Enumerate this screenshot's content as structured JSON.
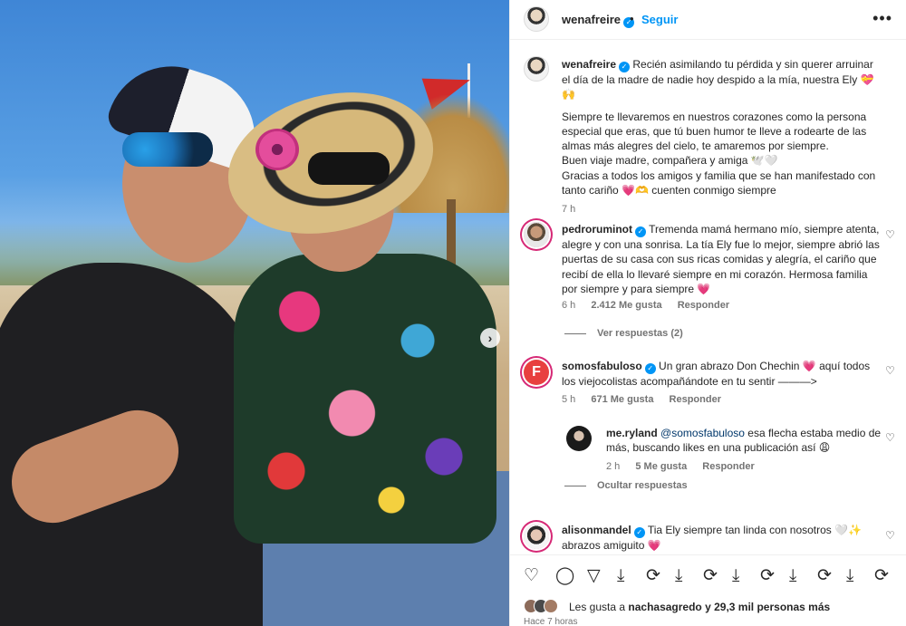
{
  "post": {
    "author": "wenafreire",
    "follow_label": "Seguir",
    "separator": "•",
    "more_label": "•••"
  },
  "caption": {
    "author": "wenafreire",
    "line1": "Recién asimilando tu pérdida y sin querer arruinar el día de la madre de nadie hoy despido a la mía, nuestra Ely 💝🙌",
    "line2": "Siempre te llevaremos en nuestros corazones como la persona especial que eras, que tú buen humor te lleve a rodearte de las almas más alegres del cielo, te amaremos por siempre.",
    "line3": "Buen viaje madre, compañera y amiga 🕊️🤍",
    "line4": "Gracias a todos los amigos y familia que se han manifestado con tanto cariño 💗🫶 cuenten conmigo siempre",
    "time": "7 h"
  },
  "comments": [
    {
      "author": "pedroruminot",
      "text": "Tremenda mamá hermano mío, siempre atenta, alegre y con una sonrisa. La tía Ely fue lo mejor, siempre abrió las puertas de su casa con sus ricas comidas y alegría, el cariño que recibí de ella lo llevaré siempre en mi corazón. Hermosa familia por siempre y para siempre 💗",
      "time": "6 h",
      "likes": "2.412 Me gusta",
      "reply": "Responder",
      "view_replies": "Ver respuestas (2)"
    },
    {
      "author": "somosfabuloso",
      "text": "Un gran abrazo Don Chechin 💗 aquí todos los viejocolistas acompañándote en tu sentir ———>",
      "time": "5 h",
      "likes": "671 Me gusta",
      "reply": "Responder",
      "hide_replies": "Ocultar respuestas"
    },
    {
      "author": "alisonmandel",
      "text": "Tia Ely siempre tan linda con nosotros 🤍✨ abrazos amiguito 💗"
    }
  ],
  "reply": {
    "author": "me.ryland",
    "mention": "@somosfabuloso",
    "text": " esa flecha estaba medio de más, buscando likes en una publicación así 😩",
    "time": "2 h",
    "likes": "5 Me gusta",
    "reply": "Responder"
  },
  "likes": {
    "prefix": "Les gusta a ",
    "user": "nachasagredo",
    "suffix": " y 29,3 mil personas más"
  },
  "time_ago": "Hace 7 horas",
  "icons": [
    "heart-icon",
    "comment-icon",
    "share-icon",
    "save-icon",
    "repost-icon"
  ]
}
